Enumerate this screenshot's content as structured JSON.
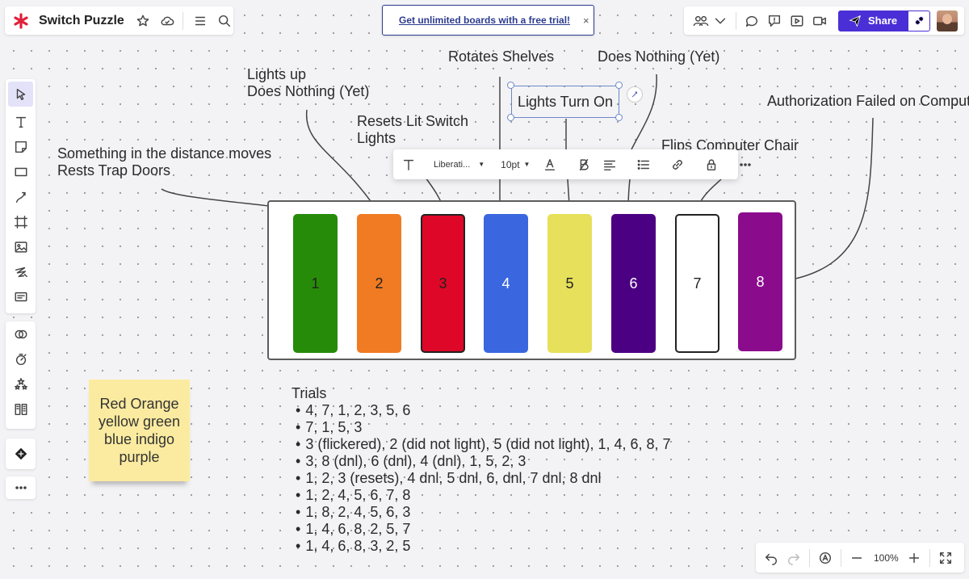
{
  "header": {
    "board_title": "Switch Puzzle",
    "banner_text": "Get unlimited boards with a free trial!",
    "banner_close": "×",
    "share_label": "Share"
  },
  "format_toolbar": {
    "font": "Liberati...",
    "size": "10pt"
  },
  "canvas": {
    "labels": {
      "lights_up": "Lights up",
      "does_nothing_1": "Does Nothing (Yet)",
      "resets_lit_1": "Resets Lit Switch",
      "resets_lit_2": "Lights",
      "rotates_shelves": "Rotates Shelves",
      "lights_turn_on": "Lights Turn On",
      "does_nothing_2": "Does Nothing (Yet)",
      "flips_chair": "Flips Computer Chair",
      "auth_failed": "Authorization Failed on Compute",
      "something_moves": "Something in the distance moves",
      "rests_trap": "Rests Trap Doors"
    },
    "switches": [
      {
        "label": "1",
        "color": "#268b09"
      },
      {
        "label": "2",
        "color": "#f07b22"
      },
      {
        "label": "3",
        "color": "#df0727"
      },
      {
        "label": "4",
        "color": "#3a67e0"
      },
      {
        "label": "5",
        "color": "#e6e05a"
      },
      {
        "label": "6",
        "color": "#4b0083"
      },
      {
        "label": "7",
        "color": "#ffffff"
      },
      {
        "label": "8",
        "color": "#8b0b8d"
      }
    ],
    "sticky_note": "Red Orange yellow green blue indigo purple",
    "trials_title": "Trials",
    "trials": [
      "4, 7, 1, 2, 3, 5, 6",
      "7, 1, 5, 3",
      "3 (flickered), 2 (did not light), 5 (did not light), 1, 4, 6, 8, 7",
      "3, 8 (dnl), 6 (dnl), 4 (dnl), 1, 5, 2, 3",
      "1, 2, 3 (resets), 4 dnl, 5 dnl, 6, dnl, 7 dnl, 8 dnl",
      "1, 2, 4, 5,  6, 7, 8",
      "1, 8, 2, 4, 5, 6, 3",
      "1, 4, 6, 8, 2, 5, 7",
      "1, 4, 6, 8, 3, 2, 5"
    ]
  },
  "footer": {
    "zoom": "100%"
  },
  "colors": {
    "accent": "#4b2fd6",
    "banner_link": "#2c3b8f",
    "sticky": "#fbeba0",
    "selection": "#6c87c9"
  }
}
